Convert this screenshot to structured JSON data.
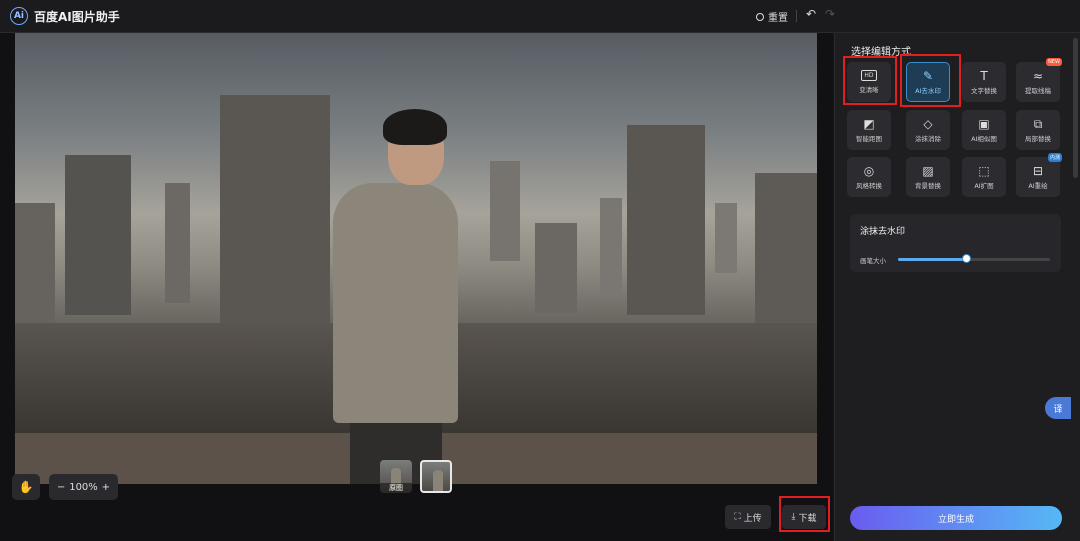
{
  "header": {
    "app_title": "百度AI图片助手",
    "logo_text": "Ai",
    "reset_label": "重置",
    "undo_icon": "↶",
    "redo_icon": "↷"
  },
  "canvas": {
    "hand_icon": "✋",
    "zoom_out": "−",
    "zoom_level": "100%",
    "zoom_in": "+",
    "thumbnails": [
      {
        "label": "原图"
      },
      {
        "label": ""
      }
    ],
    "upload_label": "上传",
    "download_label": "下载",
    "upload_icon": "⛶",
    "download_icon": "⤓"
  },
  "panel": {
    "title": "选择编辑方式",
    "tools": [
      {
        "label": "变清晰",
        "icon": "HD",
        "badge": ""
      },
      {
        "label": "AI去水印",
        "icon": "✎",
        "badge": ""
      },
      {
        "label": "文字替换",
        "icon": "T",
        "badge": ""
      },
      {
        "label": "提取线稿",
        "icon": "≈",
        "badge": "NEW"
      },
      {
        "label": "智能距图",
        "icon": "◩",
        "badge": ""
      },
      {
        "label": "涂抹消除",
        "icon": "◇",
        "badge": ""
      },
      {
        "label": "AI相似图",
        "icon": "▣",
        "badge": ""
      },
      {
        "label": "局部替换",
        "icon": "⧉",
        "badge": ""
      },
      {
        "label": "风格转换",
        "icon": "◎",
        "badge": ""
      },
      {
        "label": "背景替换",
        "icon": "▨",
        "badge": ""
      },
      {
        "label": "AI扩图",
        "icon": "⬚",
        "badge": ""
      },
      {
        "label": "AI重绘",
        "icon": "⊟",
        "badge": "内测"
      }
    ],
    "sub_title": "涂抹去水印",
    "brush_label": "画笔大小",
    "brush_size_fraction": 0.45,
    "generate_label": "立即生成",
    "translate_label": "译"
  },
  "colors": {
    "accent": "#3a8ed0",
    "highlight": "#e02020",
    "generate_start": "#6a5cf0",
    "generate_end": "#56b8f5"
  }
}
